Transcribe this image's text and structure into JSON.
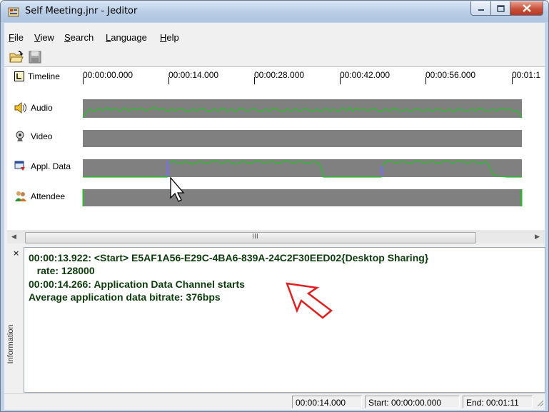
{
  "window": {
    "title": "Self Meeting.jnr - Jeditor"
  },
  "menu": {
    "items": [
      "File",
      "View",
      "Search",
      "Language",
      "Help"
    ],
    "mnemonics": [
      "F",
      "V",
      "S",
      "L",
      "H"
    ]
  },
  "toolbar": {
    "open_icon": "folder-open-icon",
    "save_icon": "save-icon"
  },
  "timeline": {
    "ruler_label": "Timeline",
    "ticks": [
      "00:00:00.000",
      "00:00:14.000",
      "00:00:28.000",
      "00:00:42.000",
      "00:00:56.000",
      "00:01:1"
    ],
    "tracks": [
      {
        "label": "Audio",
        "icon": "speaker-icon"
      },
      {
        "label": "Video",
        "icon": "webcam-icon"
      },
      {
        "label": "Appl. Data",
        "icon": "application-data-icon"
      },
      {
        "label": "Attendee",
        "icon": "people-icon"
      }
    ],
    "colors": {
      "track_bg": "#808080",
      "signal": "#22c222",
      "marker": "#7c6cf0"
    }
  },
  "scrollbar": {
    "grip": "III"
  },
  "info": {
    "side_label": "Information",
    "close": "×",
    "lines": [
      "00:00:13.922: <Start> E5AF1A56-E29C-4BA6-839A-24C2F30EED02{Desktop Sharing}",
      "   rate: 128000",
      "00:00:14.266: Application Data Channel starts",
      "Average application data bitrate: 376bps"
    ],
    "text_color": "#0b3b0b",
    "annotation_color": "#e02020"
  },
  "status": {
    "position": "00:00:14.000",
    "start": "Start: 00:00:00.000",
    "end": "End: 00:01:11"
  }
}
